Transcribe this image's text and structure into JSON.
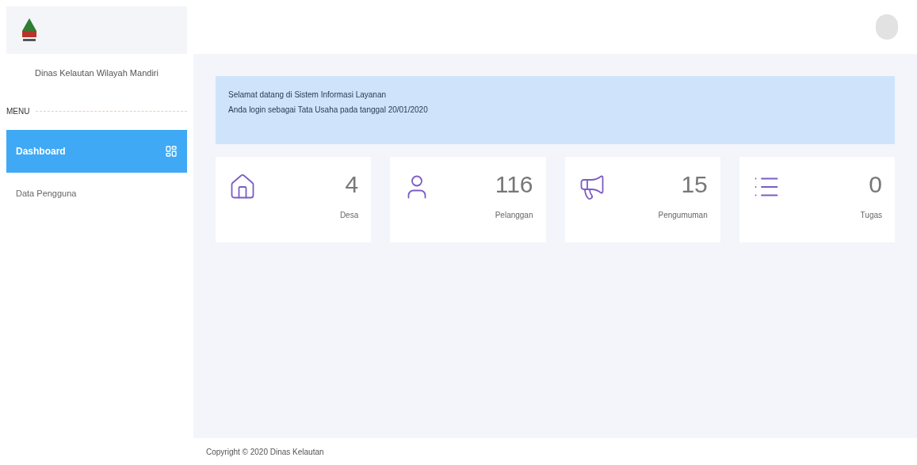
{
  "sidebar": {
    "subtitle": "Dinas Kelautan Wilayah Mandiri",
    "section": "MENU",
    "items": [
      {
        "label": "Dashboard",
        "selected": true
      },
      {
        "label": "Data Pengguna",
        "selected": false
      }
    ]
  },
  "banner": {
    "lines": [
      "Selamat datang di Sistem Informasi Layanan",
      "Anda login sebagai Tata Usaha pada tanggal 20/01/2020"
    ]
  },
  "stats": [
    {
      "kind": "home",
      "value": "4",
      "label": "Desa"
    },
    {
      "kind": "user",
      "value": "116",
      "label": "Pelanggan"
    },
    {
      "kind": "megaphone",
      "value": "15",
      "label": "Pengumuman"
    },
    {
      "kind": "list",
      "value": "0",
      "label": "Tugas"
    }
  ],
  "footer": "Copyright © 2020 Dinas Kelautan"
}
